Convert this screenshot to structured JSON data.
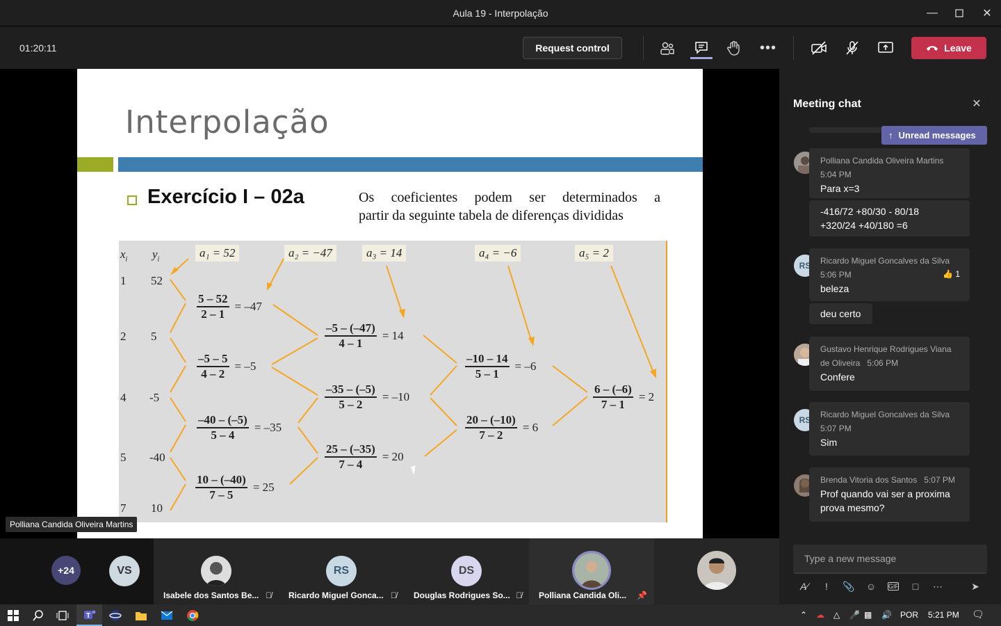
{
  "window": {
    "title": "Aula 19 - Interpolação"
  },
  "toolbar": {
    "timer": "01:20:11",
    "request_control": "Request control",
    "leave": "Leave"
  },
  "slide": {
    "title": "Interpolação",
    "exercise_title": "Exercício I – 02a",
    "text_line1": "Os coeficientes podem ser determinados a",
    "text_line2": "partir da seguinte tabela de diferenças divididas",
    "headers": {
      "x": "x",
      "xsub": "i",
      "y": "y",
      "ysub": "i"
    },
    "coefs": [
      "a₁ = 52",
      "a₂ = −47",
      "a₃ = 14",
      "a₄ = −6",
      "a₅ = 2"
    ],
    "xs": [
      "1",
      "2",
      "4",
      "5",
      "7"
    ],
    "ys": [
      "52",
      "5",
      "-5",
      "-40",
      "10"
    ],
    "col1": [
      {
        "num": "5 – 52",
        "den": "2 – 1",
        "res": "= –47"
      },
      {
        "num": "–5 – 5",
        "den": "4 – 2",
        "res": "= –5"
      },
      {
        "num": "–40 – (–5)",
        "den": "5 – 4",
        "res": "= –35"
      },
      {
        "num": "10 – (–40)",
        "den": "7 – 5",
        "res": "= 25"
      }
    ],
    "col2": [
      {
        "num": "–5 – (–47)",
        "den": "4 – 1",
        "res": "= 14"
      },
      {
        "num": "–35 – (–5)",
        "den": "5 – 2",
        "res": "= –10"
      },
      {
        "num": "25 – (–35)",
        "den": "7 – 4",
        "res": "= 20"
      }
    ],
    "col3": [
      {
        "num": "–10 – 14",
        "den": "5 – 1",
        "res": "= –6"
      },
      {
        "num": "20 – (–10)",
        "den": "7 – 2",
        "res": "= 6"
      }
    ],
    "col4": [
      {
        "num": "6 – (–6)",
        "den": "7 – 1",
        "res": "= 2"
      }
    ]
  },
  "presenter_label": "Polliana Candida Oliveira Martins",
  "chat": {
    "header": "Meeting chat",
    "unread": "Unread messages",
    "messages": [
      {
        "author": "Polliana Candida Oliveira Martins",
        "time": "5:04 PM",
        "lines": [
          "Para x=3"
        ]
      },
      {
        "author": "",
        "time": "",
        "lines": [
          "-416/72 +80/30 - 80/18",
          "+320/24 +40/180 =6"
        ]
      },
      {
        "author": "Ricardo Miguel Goncalves da Silva",
        "time": "5:06 PM",
        "lines": [
          "beleza"
        ],
        "reaction": "1"
      },
      {
        "author": "",
        "time": "",
        "lines": [
          "deu certo"
        ]
      },
      {
        "author": "Gustavo Henrique Rodrigues Viana",
        "author2": "de Oliveira",
        "time": "5:06 PM",
        "lines": [
          "Confere"
        ]
      },
      {
        "author": "Ricardo Miguel Goncalves da Silva",
        "time": "5:07 PM",
        "lines": [
          "Sim"
        ]
      },
      {
        "author": "Brenda Vitoria dos Santos",
        "time": "5:07 PM",
        "lines": [
          "Prof quando vai ser a proxima",
          "prova mesmo?"
        ]
      }
    ],
    "avatar_rs": "RS",
    "compose_placeholder": "Type a new message"
  },
  "gallery": {
    "more": "+24",
    "vs": "VS",
    "tiles": [
      {
        "name": "Isabele dos Santos Be..."
      },
      {
        "name": "Ricardo Miguel Gonca...",
        "initials": "RS"
      },
      {
        "name": "Douglas Rodrigues So...",
        "initials": "DS"
      },
      {
        "name": "Polliana Candida Oli..."
      }
    ]
  },
  "taskbar": {
    "lang": "POR",
    "time": "5:21 PM"
  },
  "colors": {
    "leave": "#c4314b",
    "accent": "#6264a7",
    "slide_blue": "#3f7fb0",
    "slide_green": "#9bab25",
    "arrow": "#f0a020"
  }
}
